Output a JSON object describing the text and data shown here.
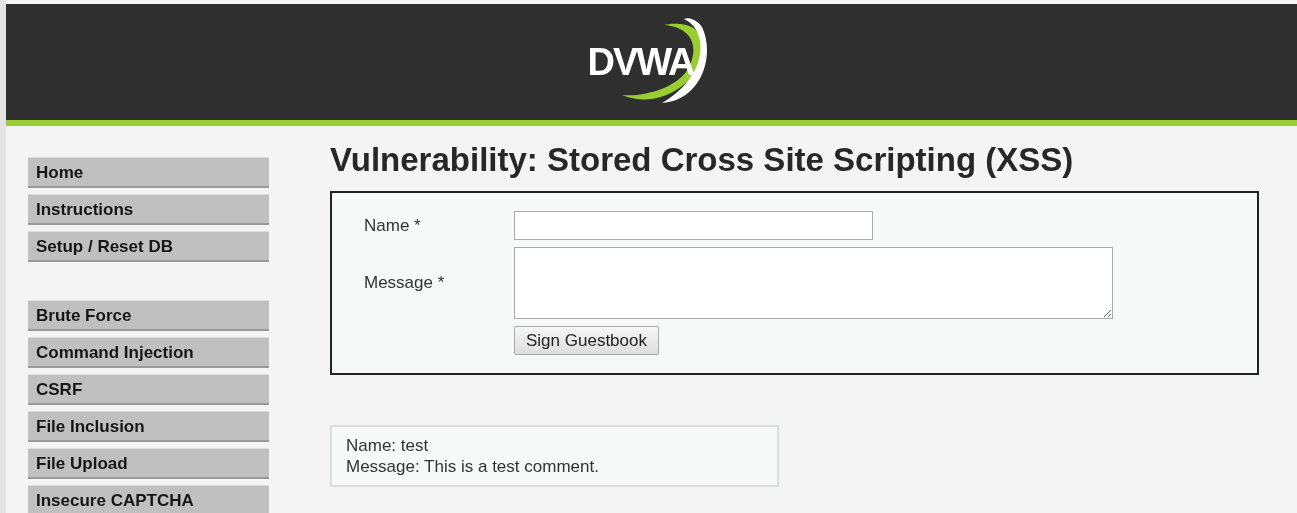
{
  "header": {
    "logo_text": "DVWA"
  },
  "menu_groups": [
    [
      {
        "label": "Home"
      },
      {
        "label": "Instructions"
      },
      {
        "label": "Setup / Reset DB"
      }
    ],
    [
      {
        "label": "Brute Force"
      },
      {
        "label": "Command Injection"
      },
      {
        "label": "CSRF"
      },
      {
        "label": "File Inclusion"
      },
      {
        "label": "File Upload"
      },
      {
        "label": "Insecure CAPTCHA"
      }
    ]
  ],
  "title": "Vulnerability: Stored Cross Site Scripting (XSS)",
  "form": {
    "name_label": "Name *",
    "message_label": "Message *",
    "submit": "Sign Guestbook"
  },
  "entries": [
    {
      "name_line": "Name: test",
      "message_line": "Message: This is a test comment."
    }
  ]
}
